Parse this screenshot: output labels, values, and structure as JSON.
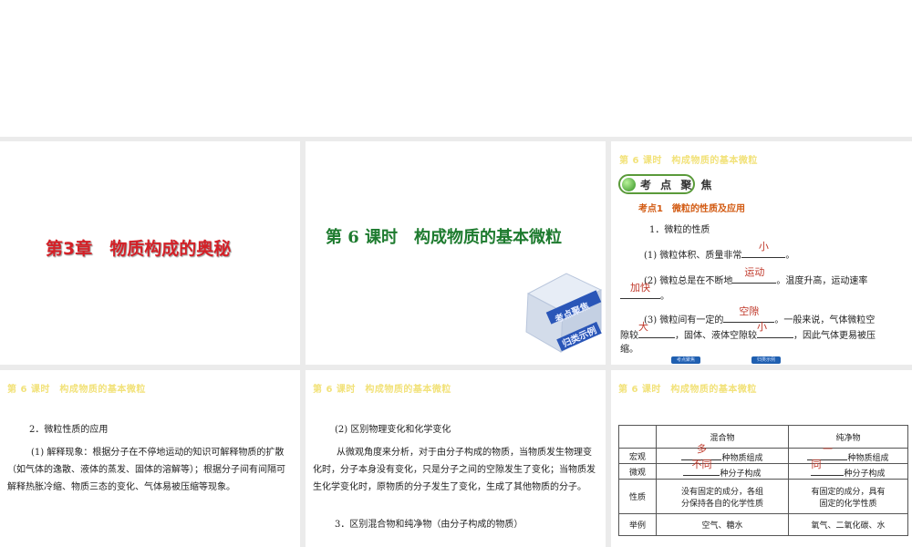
{
  "header": "第 6 课时　构成物质的基本微粒",
  "slide1": {
    "title": "第3章　物质构成的奥秘"
  },
  "slide2": {
    "title": "第 6 课时　构成物质的基本微粒",
    "cube_labels": [
      "考点聚焦",
      "归类示例"
    ]
  },
  "slide3": {
    "badge": "考 点 聚 焦",
    "kp_title": "考点1　微粒的性质及应用",
    "item1": "1．微粒的性质",
    "l1_pre": "(1) 微粒体积、质量非常",
    "l1_ans": "小",
    "l1_post": "。",
    "l2_pre": "(2) 微粒总是在不断地",
    "l2_ans": "运动",
    "l2_post": "。温度升高，运动速率",
    "l3_ans": "加快",
    "l3_post": "。",
    "l4_pre": "(3) 微粒间有一定的",
    "l4_ans": "空隙",
    "l4_post": "。一般来说，气体微粒空",
    "l5_pre": "隙较",
    "l5_ans1": "大",
    "l5_mid": "，固体、液体空隙较",
    "l5_ans2": "小",
    "l5_post": "，因此气体更易被压",
    "l6": "缩。",
    "nav": [
      "考点聚焦",
      "归类示例"
    ]
  },
  "slide4": {
    "heading": "2．微粒性质的应用",
    "para": "(1) 解释现象：根据分子在不停地运动的知识可解释物质的扩散（如气体的逸散、液体的蒸发、固体的溶解等）；根据分子间有间隔可解释热胀冷缩、物质三态的变化、气体易被压缩等现象。"
  },
  "slide5": {
    "heading": "(2) 区别物理变化和化学变化",
    "para": "从微观角度来分析，对于由分子构成的物质，当物质发生物理变化时，分子本身没有变化，只是分子之间的空隙发生了变化；当物质发生化学变化时，原物质的分子发生了变化，生成了其他物质的分子。",
    "item3": "3．区别混合物和纯净物（由分子构成的物质）"
  },
  "slide6": {
    "col_headers": [
      "混合物",
      "纯净物"
    ],
    "rows": [
      {
        "label": "宏观",
        "mix_ans": "多",
        "mix_text": "种物质组成",
        "pure_ans": "一",
        "pure_text": "种物质组成"
      },
      {
        "label": "微观",
        "mix_ans": "不同",
        "mix_text": "种分子构成",
        "pure_ans": "同",
        "pure_text": "种分子构成"
      },
      {
        "label": "性质",
        "mix_l1": "没有固定的成分，各组",
        "mix_l2": "分保持各自的化学性质",
        "pure_l1": "有固定的成分，具有",
        "pure_l2": "固定的化学性质"
      },
      {
        "label": "举例",
        "mix": "空气、糖水",
        "pure": "氧气、二氧化碳、水"
      }
    ]
  }
}
